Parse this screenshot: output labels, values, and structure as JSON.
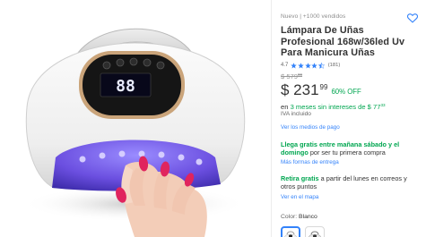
{
  "product": {
    "condition_sold": "Nuevo  |  +1000 vendidos",
    "title": "Lámpara De Uñas Profesional 168w/36led Uv Para Manicura Uñas",
    "rating": {
      "value": "4.7",
      "stars_filled": 4.5,
      "count": "(181)"
    },
    "old_price": {
      "main": "$ 579",
      "cents": "99"
    },
    "price": {
      "main": "$ 231",
      "cents": "99",
      "discount": "60% OFF"
    },
    "installments": {
      "prefix": "en ",
      "green": "3 meses sin intereses de $ 77",
      "cents": "33"
    },
    "iva": "IVA incluido",
    "payment_link": "Ver los medios de pago",
    "shipping": {
      "bold": "Llega gratis entre mañana sábado y el domingo",
      "rest": " por ser tu primera compra",
      "link": "Más formas de entrega"
    },
    "pickup": {
      "bold": "Retira gratis",
      "rest": " a partir del lunes en correos y otros puntos",
      "link": "Ver en el mapa"
    },
    "color": {
      "label": "Color: ",
      "value": "Blanco"
    }
  },
  "lamp_display": "88",
  "colors": {
    "accent_blue": "#3483fa",
    "green": "#00a650",
    "star": "#3483fa",
    "heart": "#3483fa"
  },
  "icons": {
    "favorite": "heart-outline-icon",
    "star": "star-icon"
  }
}
